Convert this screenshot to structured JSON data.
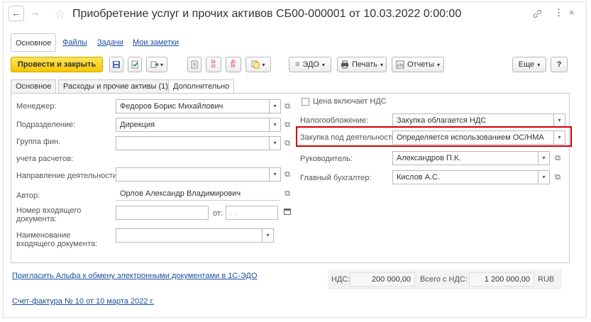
{
  "window": {
    "title": "Приобретение услуг и прочих активов СБ00-000001 от 10.03.2022 0:00:00",
    "back": "←",
    "forward": "→",
    "star": "☆",
    "link_icon": "🔗",
    "more": "⋮",
    "close": "×"
  },
  "sections": [
    "Основное",
    "Файлы",
    "Задачи",
    "Мои заметки"
  ],
  "toolbar": {
    "post_close": "Провести и закрыть",
    "edo": "ЭДО",
    "print": "Печать",
    "reports": "Отчеты",
    "more": "Еще",
    "help": "?",
    "dtkt_top": "Дт",
    "dtkt_bottom": "Кт",
    "drcr_top": "Dr",
    "drcr_bottom": "Cr"
  },
  "tabs": [
    "Основное",
    "Расходы и прочие активы (1)",
    "Дополнительно"
  ],
  "left": {
    "manager_label": "Менеджер:",
    "manager_value": "Федоров Борис Михайлович",
    "department_label": "Подразделение:",
    "department_value": "Дирекция",
    "fin_group_label": "Группа фин.",
    "fin_group_label2": "учета расчетов:",
    "fin_group_value": "",
    "direction_label": "Направление деятельности:",
    "direction_value": "",
    "author_label": "Автор:",
    "author_value": "Орлов Александр Владимирович",
    "in_doc_num_label": "Номер входящего документа:",
    "in_doc_num_value": "",
    "from_label": "от:",
    "from_value": " .  .",
    "in_doc_name_label": "Наименование входящего документа:",
    "in_doc_name_value": ""
  },
  "right": {
    "vat_included_label": "Цена включает НДС",
    "taxation_label": "Налогообложение:",
    "taxation_value": "Закупка облагается НДС",
    "purchase_label": "Закупка под деятельность:",
    "purchase_value": "Определяется использованием ОС/НМА",
    "head_label": "Руководитель:",
    "head_value": "Александров П.К.",
    "accountant_label": "Главный бухгалтер:",
    "accountant_value": "Кислов А.С."
  },
  "footer": {
    "invite_link": "Пригласить Альфа к обмену электронными документами в 1С-ЭДО",
    "invoice_link": "Счет-фактура № 10 от 10 марта 2022 г.",
    "vat_label": "НДС:",
    "vat_value": "200 000,00",
    "total_label": "Всего с НДС:",
    "total_value": "1 200 000,00",
    "currency": "RUB"
  },
  "colors": {
    "accent_yellow": "#f5c800",
    "highlight_red": "#d40000",
    "link_blue": "#1a4fa0"
  }
}
